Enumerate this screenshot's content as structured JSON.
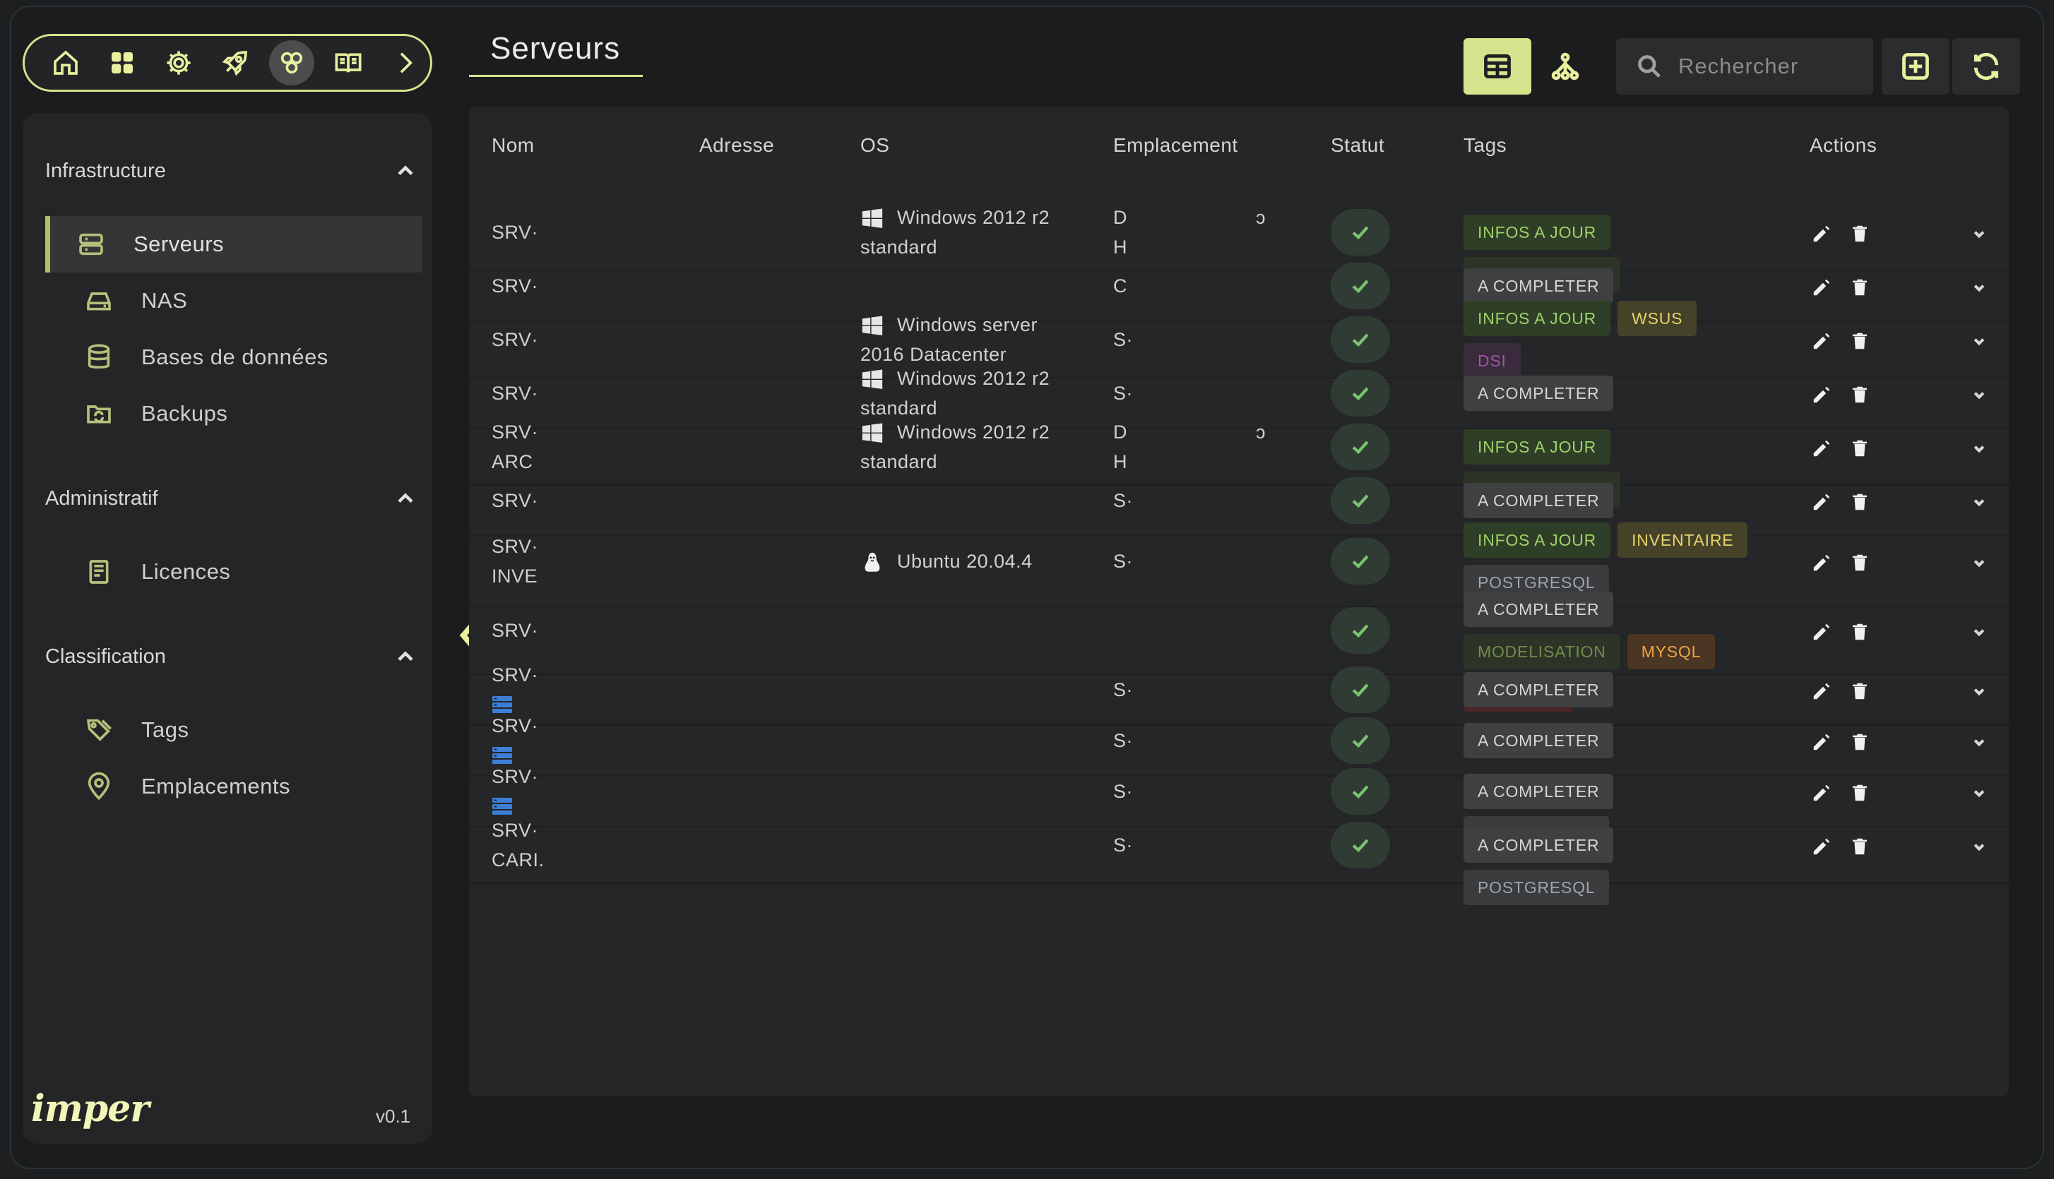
{
  "page": {
    "title": "Serveurs"
  },
  "topbar": {
    "icons": [
      "home-icon",
      "apps-icon",
      "settings-icon",
      "rocket-icon",
      "network-icon",
      "book-icon",
      "chevron-right-icon"
    ],
    "active_index": 4
  },
  "sidebar": {
    "sections": [
      {
        "label": "Infrastructure",
        "items": [
          {
            "label": "Serveurs",
            "icon": "server-icon",
            "active": true
          },
          {
            "label": "NAS",
            "icon": "drive-icon"
          },
          {
            "label": "Bases de données",
            "icon": "database-icon"
          },
          {
            "label": "Backups",
            "icon": "folder-sync-icon"
          }
        ]
      },
      {
        "label": "Administratif",
        "items": [
          {
            "label": "Licences",
            "icon": "document-icon"
          }
        ]
      },
      {
        "label": "Classification",
        "items": [
          {
            "label": "Tags",
            "icon": "tags-icon"
          },
          {
            "label": "Emplacements",
            "icon": "location-icon"
          }
        ]
      }
    ],
    "logo": "imper",
    "version": "v0.1"
  },
  "search": {
    "placeholder": "Rechercher"
  },
  "table": {
    "columns": [
      "Nom",
      "Adresse",
      "OS",
      "Emplacement",
      "Statut",
      "Tags",
      "Actions"
    ],
    "rows": [
      {
        "name": [
          "SRV·"
        ],
        "os_icon": "windows-icon",
        "os": [
          "Windows 2012 r2",
          "standard"
        ],
        "location": [
          "D",
          "H"
        ],
        "location_extra": "ↄ",
        "status": "ok",
        "tags": [
          [
            "INFOS A JOUR",
            "green"
          ],
          [
            "MODELISATION",
            "olive"
          ]
        ]
      },
      {
        "name": [
          "SRV·"
        ],
        "os_icon": "",
        "os": [],
        "location": [
          "C"
        ],
        "status": "ok",
        "tags": [
          [
            "A COMPLETER",
            "grey"
          ]
        ]
      },
      {
        "name": [
          "SRV·"
        ],
        "os_icon": "windows-icon",
        "os": [
          "Windows server",
          "2016 Datacenter"
        ],
        "location": [
          "S·"
        ],
        "status": "ok",
        "tags": [
          [
            "INFOS A JOUR",
            "green"
          ],
          [
            "WSUS",
            "yellow"
          ],
          [
            "DSI",
            "purple"
          ]
        ]
      },
      {
        "name": [
          "SRV·"
        ],
        "os_icon": "windows-icon",
        "os": [
          "Windows 2012 r2",
          "standard"
        ],
        "location": [
          "S·"
        ],
        "status": "ok",
        "tags": [
          [
            "A COMPLETER",
            "grey"
          ]
        ]
      },
      {
        "name": [
          "SRV·",
          "ARC"
        ],
        "os_icon": "windows-icon",
        "os": [
          "Windows 2012 r2",
          "standard"
        ],
        "location": [
          "D",
          "H"
        ],
        "location_extra": "ↄ",
        "status": "ok",
        "tags": [
          [
            "INFOS A JOUR",
            "green"
          ],
          [
            "MODELISATION",
            "olive"
          ]
        ]
      },
      {
        "name": [
          "SRV·"
        ],
        "os_icon": "",
        "os": [],
        "location": [
          "S·"
        ],
        "status": "ok",
        "tags": [
          [
            "A COMPLETER",
            "grey"
          ]
        ]
      },
      {
        "name": [
          "SRV·",
          "INVE"
        ],
        "os_icon": "linux-icon",
        "os": [
          "Ubuntu 20.04.4"
        ],
        "location": [
          "S·"
        ],
        "status": "ok",
        "tags": [
          [
            "INFOS A JOUR",
            "green"
          ],
          [
            "INVENTAIRE",
            "yellow"
          ],
          [
            "POSTGRESQL",
            "steel"
          ]
        ]
      },
      {
        "name": [
          "SRV·"
        ],
        "os_icon": "",
        "os": [],
        "location": [],
        "status": "ok",
        "tags": [
          [
            "A COMPLETER",
            "grey"
          ],
          [
            "MODELISATION",
            "olive"
          ],
          [
            "MYSQL",
            "orange"
          ],
          [
            "CRITIQUE",
            "red"
          ]
        ]
      },
      {
        "name": [
          "SRV·"
        ],
        "server_badge": true,
        "os_icon": "",
        "os": [],
        "location": [
          "S·"
        ],
        "status": "ok",
        "tags": [
          [
            "A COMPLETER",
            "grey"
          ]
        ]
      },
      {
        "name": [
          "SRV·"
        ],
        "server_badge": true,
        "os_icon": "",
        "os": [],
        "location": [
          "S·"
        ],
        "status": "ok",
        "tags": [
          [
            "A COMPLETER",
            "grey"
          ]
        ]
      },
      {
        "name": [
          "SRV·"
        ],
        "server_badge": true,
        "os_icon": "",
        "os": [],
        "location": [
          "S·"
        ],
        "status": "ok",
        "tags": [
          [
            "A COMPLETER",
            "grey"
          ],
          [
            "POSTGRESQL",
            "steel"
          ]
        ]
      },
      {
        "name": [
          "SRV·",
          "CARI."
        ],
        "os_icon": "",
        "os": [],
        "location": [
          "S·"
        ],
        "status": "ok",
        "tags": [
          [
            "A COMPLETER",
            "grey"
          ],
          [
            "POSTGRESQL",
            "steel"
          ]
        ]
      }
    ]
  },
  "colors": {
    "accent": "#d6e28c",
    "background": "#1b1c1d",
    "panel": "#242627",
    "status_ok": "#7cc36f"
  }
}
